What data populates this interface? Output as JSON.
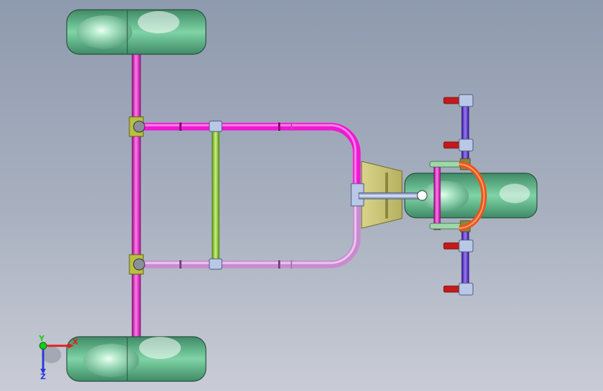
{
  "viewport": {
    "background_top": "#8e9aae",
    "background_bottom": "#c9ccd6"
  },
  "model": {
    "frame_color_main": "#f019d2",
    "frame_color_lower": "#c98bd0",
    "crossbar_color": "#8fd42c",
    "tire_color": "#6fc79a",
    "steering_color": "#e8571a",
    "tie_rod_color": "#6e43d6",
    "bolt_color": "#c41a1a",
    "plate_color": "#c9c57a",
    "shaft_color": "#a9b9dc"
  },
  "triad": {
    "x_label": "X",
    "y_label": "Y",
    "z_label": "Z",
    "x_color": "#e0201a",
    "y_color": "#18c81a",
    "z_color": "#2a3ad8"
  }
}
